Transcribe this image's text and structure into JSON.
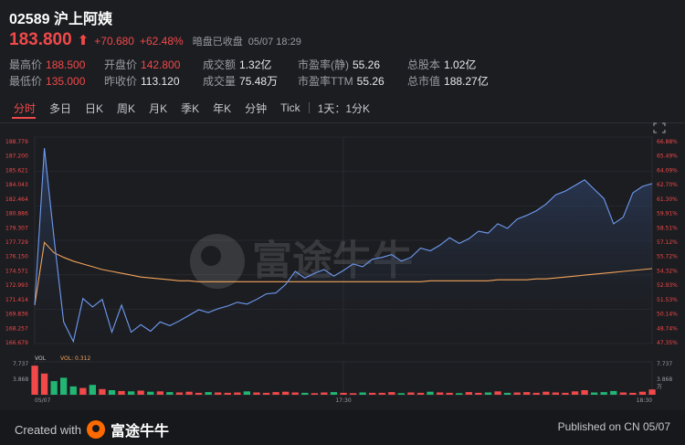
{
  "header": {
    "code": "02589",
    "name": "沪上阿姨",
    "price": "183.800",
    "change": "+70.680",
    "change_pct": "+62.48%",
    "status": "暗盘已收盘",
    "datetime": "05/07 18:29"
  },
  "stats": {
    "high_label": "最高价",
    "high": "188.500",
    "open_label": "开盘价",
    "open": "142.800",
    "turnover_label": "成交额",
    "turnover": "1.32亿",
    "pe_static_label": "市盈率(静)",
    "pe_static": "55.26",
    "total_shares_label": "总股本",
    "total_shares": "1.02亿",
    "low_label": "最低价",
    "low": "135.000",
    "prev_close_label": "昨收价",
    "prev_close": "113.120",
    "volume_label": "成交量",
    "volume": "75.48万",
    "pe_ttm_label": "市盈率TTM",
    "pe_ttm": "55.26",
    "market_cap_label": "总市值",
    "market_cap": "188.27亿"
  },
  "tabs": [
    "分时",
    "多日",
    "日K",
    "周K",
    "月K",
    "季K",
    "年K",
    "分钟",
    "Tick"
  ],
  "active_tab": "分时",
  "period_selector": "1天：1分K",
  "chart_data": {
    "type": "line",
    "price_ticks": [
      "188.779",
      "187.200",
      "185.621",
      "184.043",
      "182.464",
      "180.886",
      "179.307",
      "177.729",
      "176.150",
      "174.571",
      "172.993",
      "171.414",
      "169.836",
      "168.257",
      "166.679"
    ],
    "pct_ticks": [
      "66.88%",
      "65.49%",
      "64.09%",
      "62.70%",
      "61.30%",
      "59.91%",
      "58.51%",
      "57.12%",
      "55.72%",
      "54.32%",
      "52.93%",
      "51.53%",
      "50.14%",
      "48.74%",
      "47.35%"
    ],
    "ylim": [
      166.679,
      188.779
    ],
    "price_series": [
      170.8,
      187.6,
      178.0,
      169.0,
      166.9,
      171.5,
      170.6,
      171.4,
      167.9,
      170.8,
      167.9,
      168.7,
      168.0,
      169.0,
      168.6,
      169.1,
      169.7,
      170.3,
      170.0,
      170.4,
      170.7,
      171.1,
      170.9,
      171.4,
      172.0,
      172.1,
      173.0,
      174.4,
      173.7,
      174.2,
      174.6,
      173.9,
      174.5,
      175.2,
      174.9,
      175.7,
      175.9,
      176.2,
      175.5,
      175.9,
      176.9,
      176.6,
      177.2,
      178.0,
      177.4,
      177.9,
      178.7,
      178.5,
      179.5,
      179.0,
      180.0,
      180.4,
      180.9,
      181.6,
      182.6,
      183.0,
      183.6,
      184.2,
      183.2,
      182.2,
      179.5,
      180.2,
      182.8,
      183.5,
      183.8
    ],
    "avg_series": [
      170.8,
      177.5,
      176.4,
      175.9,
      175.5,
      175.2,
      174.9,
      174.6,
      174.4,
      174.2,
      174.0,
      173.8,
      173.7,
      173.6,
      173.5,
      173.4,
      173.4,
      173.3,
      173.3,
      173.3,
      173.3,
      173.3,
      173.3,
      173.3,
      173.3,
      173.3,
      173.3,
      173.3,
      173.3,
      173.3,
      173.3,
      173.3,
      173.3,
      173.3,
      173.3,
      173.3,
      173.3,
      173.3,
      173.3,
      173.3,
      173.3,
      173.4,
      173.4,
      173.4,
      173.4,
      173.4,
      173.4,
      173.4,
      173.5,
      173.5,
      173.5,
      173.5,
      173.6,
      173.6,
      173.7,
      173.8,
      173.9,
      174.0,
      174.1,
      174.2,
      174.3,
      174.4,
      174.5,
      174.6,
      174.7
    ],
    "volume_ticks": [
      "7.737",
      "3.868",
      "万"
    ],
    "volume_legend": "VOL",
    "volume_value_label": "VOL: 0.312",
    "volume_series": [
      7.7,
      5.6,
      3.6,
      4.5,
      2.2,
      1.8,
      2.6,
      1.5,
      1.2,
      1.0,
      0.9,
      1.1,
      0.8,
      0.9,
      0.7,
      0.6,
      0.8,
      0.5,
      0.7,
      0.6,
      0.5,
      0.6,
      0.9,
      0.6,
      0.5,
      0.7,
      0.8,
      0.6,
      0.5,
      0.4,
      0.6,
      0.7,
      0.5,
      0.4,
      0.6,
      0.5,
      0.5,
      0.7,
      0.4,
      0.6,
      0.5,
      0.8,
      0.6,
      0.5,
      0.4,
      0.7,
      0.5,
      0.6,
      0.9,
      0.5,
      0.6,
      0.7,
      0.5,
      0.8,
      0.6,
      0.5,
      0.9,
      1.2,
      0.6,
      0.7,
      1.0,
      0.6,
      0.5,
      0.8,
      1.4
    ],
    "x_labels": [
      "05/07",
      "17:30",
      "18:30"
    ],
    "colors": {
      "price_line": "#6f9bf2",
      "avg_line": "#f2a35a",
      "up": "#f1494a",
      "down": "#22b573"
    }
  },
  "watermark": "富途牛牛",
  "footer": {
    "created_with": "Created with",
    "brand": "富途牛牛",
    "published": "Published on CN 05/07"
  }
}
